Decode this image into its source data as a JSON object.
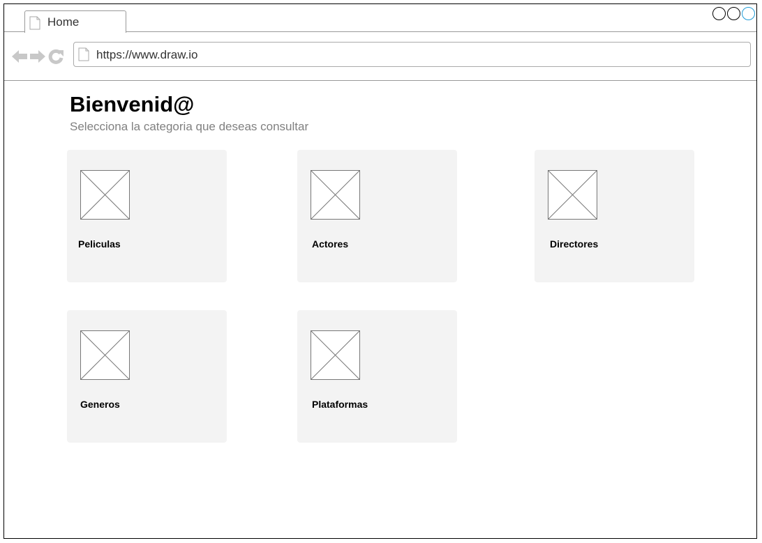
{
  "browser": {
    "tab_title": "Home",
    "url": "https://www.draw.io",
    "accent_color": "#1f9bd7"
  },
  "icons": {
    "tab": "page-icon",
    "back": "arrow-left-icon",
    "forward": "arrow-right-icon",
    "reload": "reload-icon",
    "url": "page-icon",
    "card_image": "image-placeholder-icon"
  },
  "main": {
    "title": "Bienvenid@",
    "subtitle": "Selecciona la categoria que deseas consultar",
    "categories": [
      {
        "label": "Peliculas"
      },
      {
        "label": "Actores"
      },
      {
        "label": "Directores"
      },
      {
        "label": "Generos"
      },
      {
        "label": "Plataformas"
      }
    ]
  }
}
